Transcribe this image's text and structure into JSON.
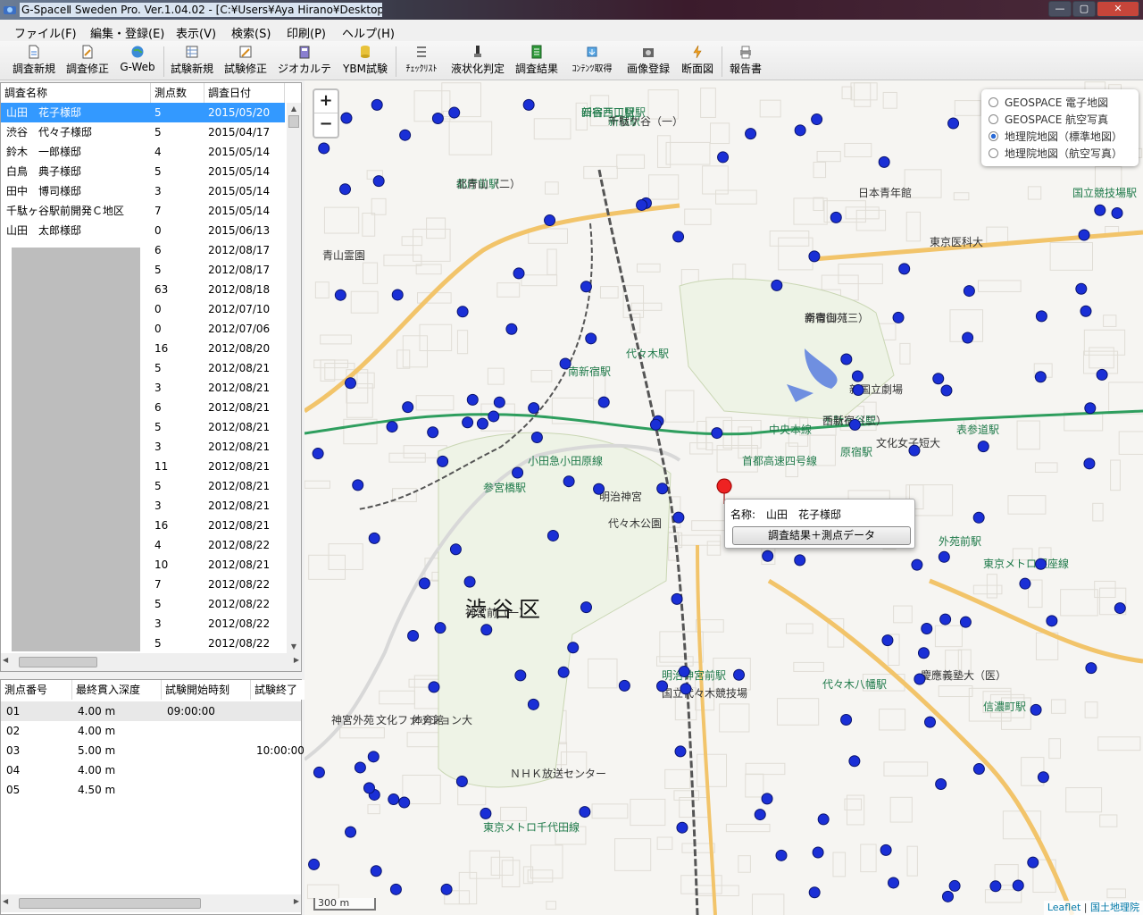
{
  "window": {
    "title": "G-SpaceⅡ Sweden Pro. Ver.1.04.02 - [C:¥Users¥Aya Hirano¥Desktop",
    "minimize": "—",
    "maximize": "▢",
    "close": "✕"
  },
  "menu": [
    "ファイル(F)",
    "編集・登録(E)",
    "表示(V)",
    "検索(S)",
    "印刷(P)",
    "ヘルプ(H)"
  ],
  "toolbar": {
    "buttons": [
      {
        "label": "調査新規",
        "icon": "new-survey-icon"
      },
      {
        "label": "調査修正",
        "icon": "edit-survey-icon"
      },
      {
        "label": "G-Web",
        "icon": "globe-icon"
      },
      {
        "label": "試験新規",
        "icon": "new-test-icon"
      },
      {
        "label": "試験修正",
        "icon": "edit-test-icon"
      },
      {
        "label": "ジオカルテ",
        "icon": "geo-chart-icon"
      },
      {
        "label": "YBM試験",
        "icon": "ybm-icon"
      },
      {
        "label": "ﾁｪｯｸﾘｽﾄ",
        "icon": "checklist-icon"
      },
      {
        "label": "液状化判定",
        "icon": "liquefaction-icon"
      },
      {
        "label": "調査結果",
        "icon": "survey-result-icon"
      },
      {
        "label": "ｺﾝﾃﾝﾂ取得",
        "icon": "content-fetch-icon"
      },
      {
        "label": "画像登録",
        "icon": "image-register-icon"
      },
      {
        "label": "断面図",
        "icon": "section-icon"
      },
      {
        "label": "報告書",
        "icon": "report-icon"
      }
    ]
  },
  "survey_list": {
    "columns": [
      "調査名称",
      "測点数",
      "調査日付"
    ],
    "rows": [
      [
        "山田　花子様邸",
        "5",
        "2015/05/20"
      ],
      [
        "渋谷　代々子様邸",
        "5",
        "2015/04/17"
      ],
      [
        "鈴木　一郎様邸",
        "4",
        "2015/05/14"
      ],
      [
        "白鳥　典子様邸",
        "5",
        "2015/05/14"
      ],
      [
        "田中　博司様邸",
        "3",
        "2015/05/14"
      ],
      [
        "千駄ヶ谷駅前開発Ｃ地区",
        "7",
        "2015/05/14"
      ],
      [
        "山田　太郎様邸",
        "0",
        "2015/06/13"
      ],
      [
        "",
        "6",
        "2012/08/17"
      ],
      [
        "",
        "5",
        "2012/08/17"
      ],
      [
        "",
        "63",
        "2012/08/18"
      ],
      [
        "",
        "0",
        "2012/07/10"
      ],
      [
        "",
        "0",
        "2012/07/06"
      ],
      [
        "",
        "16",
        "2012/08/20"
      ],
      [
        "",
        "5",
        "2012/08/21"
      ],
      [
        "",
        "3",
        "2012/08/21"
      ],
      [
        "",
        "6",
        "2012/08/21"
      ],
      [
        "",
        "5",
        "2012/08/21"
      ],
      [
        "",
        "3",
        "2012/08/21"
      ],
      [
        "",
        "11",
        "2012/08/21"
      ],
      [
        "",
        "5",
        "2012/08/21"
      ],
      [
        "",
        "3",
        "2012/08/21"
      ],
      [
        "",
        "16",
        "2012/08/21"
      ],
      [
        "",
        "4",
        "2012/08/22"
      ],
      [
        "",
        "10",
        "2012/08/21"
      ],
      [
        "",
        "7",
        "2012/08/22"
      ],
      [
        "",
        "5",
        "2012/08/22"
      ],
      [
        "",
        "3",
        "2012/08/22"
      ],
      [
        "",
        "5",
        "2012/08/22"
      ]
    ]
  },
  "point_list": {
    "columns": [
      "測点番号",
      "最終貫入深度",
      "試験開始時刻",
      "試験終了"
    ],
    "rows": [
      [
        "01",
        "4.00 m",
        "09:00:00",
        ""
      ],
      [
        "02",
        "4.00 m",
        "",
        ""
      ],
      [
        "03",
        "5.00 m",
        "",
        "10:00:00"
      ],
      [
        "04",
        "4.00 m",
        "",
        ""
      ],
      [
        "05",
        "4.50 m",
        "",
        ""
      ]
    ]
  },
  "map": {
    "zoom_in": "+",
    "zoom_out": "−",
    "layers": [
      {
        "label": "GEOSPACE 電子地図",
        "selected": false
      },
      {
        "label": "GEOSPACE 航空写真",
        "selected": false
      },
      {
        "label": "地理院地図（標準地図）",
        "selected": true
      },
      {
        "label": "地理院地図（航空写真）",
        "selected": false
      }
    ],
    "popup": {
      "name": "名称:　山田　花子様邸",
      "button": "調査結果＋測点データ"
    },
    "scale": "300 m",
    "attribution_leaflet": "Leaflet",
    "attribution_sep": "|",
    "attribution_gsi": "国土地理院",
    "labels": [
      {
        "t": "渋谷区",
        "big": true
      },
      {
        "t": "新宿駅"
      },
      {
        "t": "新宿西口駅"
      },
      {
        "t": "都庁前駅"
      },
      {
        "t": "新宿御苑"
      },
      {
        "t": "千駄ヶ谷駅"
      },
      {
        "t": "代々木駅"
      },
      {
        "t": "南新宿駅"
      },
      {
        "t": "参宮橋駅"
      },
      {
        "t": "小田急小田原線"
      },
      {
        "t": "中央本線"
      },
      {
        "t": "首都高速四号線"
      },
      {
        "t": "明治神宮"
      },
      {
        "t": "代々木公園"
      },
      {
        "t": "原宿駅"
      },
      {
        "t": "表参道駅"
      },
      {
        "t": "国立競技場駅"
      },
      {
        "t": "体育館"
      },
      {
        "t": "神宮外苑"
      },
      {
        "t": "外苑前駅"
      },
      {
        "t": "東京メトロ銀座線"
      },
      {
        "t": "東京メトロ千代田線"
      },
      {
        "t": "ＮＨＫ放送センター"
      },
      {
        "t": "国立代々木競技場"
      },
      {
        "t": "明治神宮前駅"
      },
      {
        "t": "代々木八幡駅"
      },
      {
        "t": "文化ファッション大"
      },
      {
        "t": "文化女子短大"
      },
      {
        "t": "新国立劇場"
      },
      {
        "t": "東京医科大"
      },
      {
        "t": "慶應義塾大（医）"
      },
      {
        "t": "信濃町駅"
      },
      {
        "t": "青山霊園"
      },
      {
        "t": "日本青年館"
      },
      {
        "t": "神宮前（一）"
      },
      {
        "t": "千駄ケ谷（一）"
      },
      {
        "t": "四谷三丁目駅"
      },
      {
        "t": "北青山（二）"
      },
      {
        "t": "南青山（三）"
      },
      {
        "t": "西新宿（二）"
      }
    ],
    "point_color": "#1a2fd6"
  }
}
